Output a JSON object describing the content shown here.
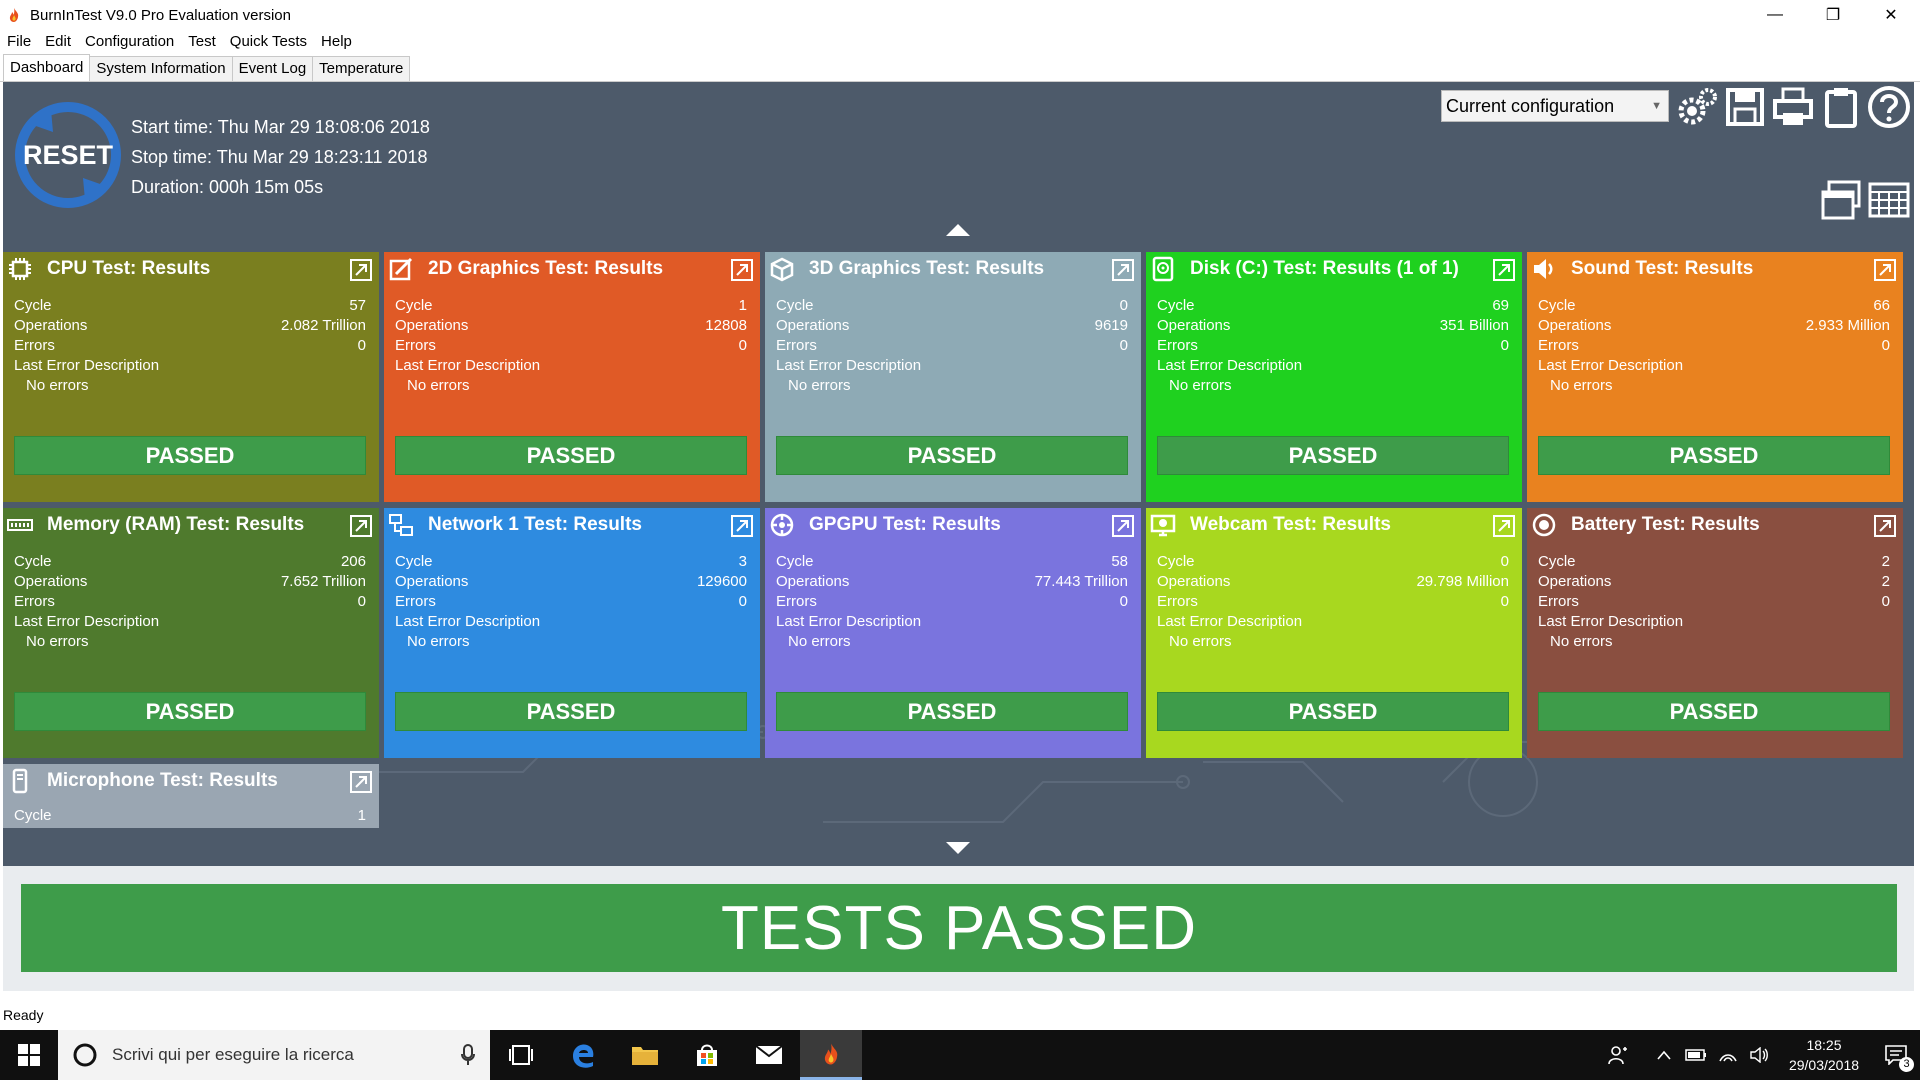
{
  "window": {
    "title": "BurnInTest V9.0 Pro Evaluation version",
    "minimize": "—",
    "maximize": "❐",
    "close": "✕"
  },
  "menu": [
    "File",
    "Edit",
    "Configuration",
    "Test",
    "Quick Tests",
    "Help"
  ],
  "tabs": [
    {
      "label": "Dashboard",
      "active": true
    },
    {
      "label": "System Information",
      "active": false
    },
    {
      "label": "Event Log",
      "active": false
    },
    {
      "label": "Temperature",
      "active": false
    }
  ],
  "dashboard": {
    "reset_label": "RESET",
    "start_time": "Start time: Thu Mar 29 18:08:06 2018",
    "stop_time": "Stop time: Thu Mar 29 18:23:11 2018",
    "duration": "Duration: 000h 15m 05s",
    "config_value": "Current configuration"
  },
  "labels": {
    "cycle": "Cycle",
    "operations": "Operations",
    "errors": "Errors",
    "last_error": "Last Error Description",
    "passed": "PASSED"
  },
  "tiles": [
    {
      "title": "CPU Test: Results",
      "icon": "cpu-icon",
      "color": "#7a7f1f",
      "cycle": "57",
      "operations": "2.082 Trillion",
      "errors": "0",
      "last_error": "No errors"
    },
    {
      "title": "2D Graphics Test: Results",
      "icon": "2d-graphics-icon",
      "color": "#e05a26",
      "cycle": "1",
      "operations": "12808",
      "errors": "0",
      "last_error": "No errors"
    },
    {
      "title": "3D Graphics Test: Results",
      "icon": "3d-graphics-icon",
      "color": "#8eaab5",
      "cycle": "0",
      "operations": "9619",
      "errors": "0",
      "last_error": "No errors"
    },
    {
      "title": "Disk (C:) Test: Results (1 of 1)",
      "icon": "disk-icon",
      "color": "#1fd11f",
      "cycle": "69",
      "operations": "351 Billion",
      "errors": "0",
      "last_error": "No errors"
    },
    {
      "title": "Sound Test: Results",
      "icon": "speaker-icon",
      "color": "#e9821f",
      "cycle": "66",
      "operations": "2.933 Million",
      "errors": "0",
      "last_error": "No errors"
    },
    {
      "title": "Memory (RAM) Test: Results",
      "icon": "memory-icon",
      "color": "#4f7a2d",
      "cycle": "206",
      "operations": "7.652 Trillion",
      "errors": "0",
      "last_error": "No errors"
    },
    {
      "title": "Network 1 Test: Results",
      "icon": "network-icon",
      "color": "#2e8be0",
      "cycle": "3",
      "operations": "129600",
      "errors": "0",
      "last_error": "No errors"
    },
    {
      "title": "GPGPU Test: Results",
      "icon": "gpgpu-icon",
      "color": "#7a74de",
      "cycle": "58",
      "operations": "77.443 Trillion",
      "errors": "0",
      "last_error": "No errors"
    },
    {
      "title": "Webcam Test: Results",
      "icon": "webcam-icon",
      "color": "#a8d81f",
      "cycle": "0",
      "operations": "29.798 Million",
      "errors": "0",
      "last_error": "No errors"
    },
    {
      "title": "Battery Test: Results",
      "icon": "battery-icon",
      "color": "#8a4f40",
      "cycle": "2",
      "operations": "2",
      "errors": "0",
      "last_error": "No errors"
    }
  ],
  "microphone_tile": {
    "title": "Microphone Test: Results",
    "icon": "microphone-icon",
    "color": "#9aa6b2",
    "cycle": "1"
  },
  "summary": "TESTS PASSED",
  "status": "Ready",
  "taskbar": {
    "search_placeholder": "Scrivi qui per eseguire la ricerca",
    "time": "18:25",
    "date": "29/03/2018",
    "notifications": "3"
  }
}
